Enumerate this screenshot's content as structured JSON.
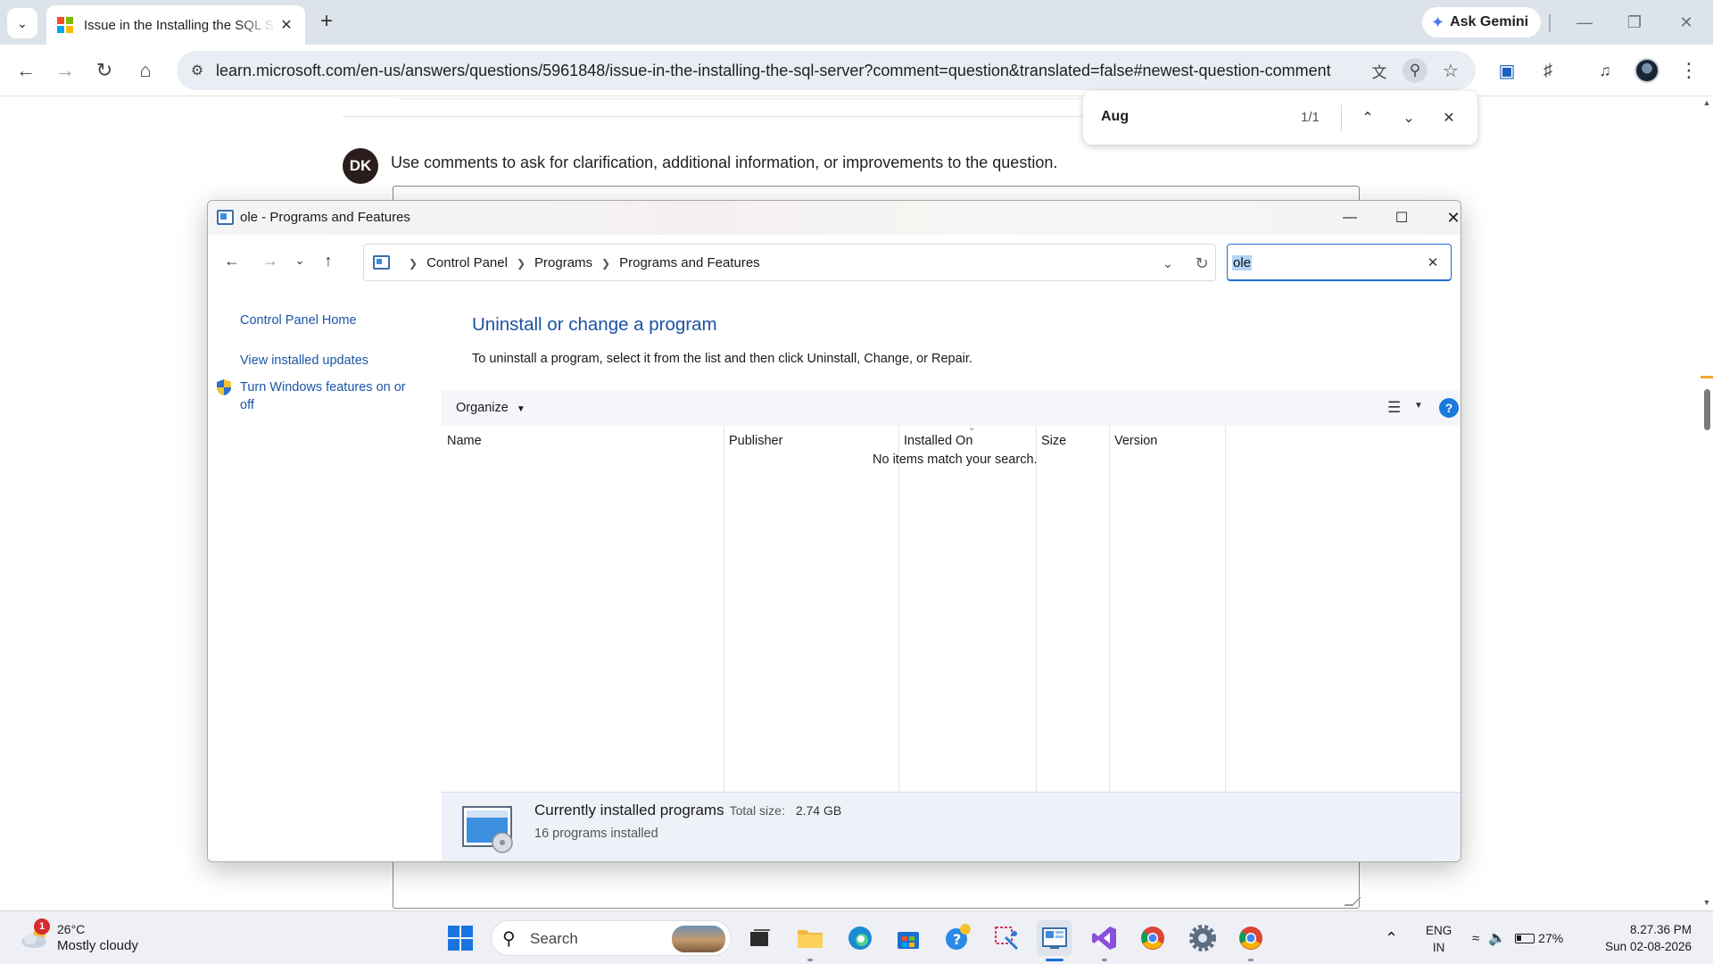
{
  "browser": {
    "tab": {
      "title": "Issue in the Installing the SQL S"
    },
    "ask_gemini": "Ask Gemini",
    "url": "learn.microsoft.com/en-us/answers/questions/5961848/issue-in-the-installing-the-sql-server?comment=question&translated=false#newest-question-comment"
  },
  "find_bar": {
    "query": "Aug",
    "count": "1/1"
  },
  "page": {
    "avatar_initials": "DK",
    "comment_hint": "Use comments to ask for clarification, additional information, or improvements to the question."
  },
  "window": {
    "title": "ole - Programs and Features",
    "breadcrumb": [
      "Control Panel",
      "Programs",
      "Programs and Features"
    ],
    "search_value": "ole",
    "left_links": {
      "home": "Control Panel Home",
      "updates": "View installed updates",
      "features_line1": "Turn Windows features on or",
      "features_line2": "off"
    },
    "heading": "Uninstall or change a program",
    "description": "To uninstall a program, select it from the list and then click Uninstall, Change, or Repair.",
    "organize": "Organize",
    "columns": [
      "Name",
      "Publisher",
      "Installed On",
      "Size",
      "Version"
    ],
    "empty_message": "No items match your search.",
    "details": {
      "title": "Currently installed programs",
      "size_label": "Total size:",
      "size_value": "2.74 GB",
      "count": "16 programs installed"
    }
  },
  "taskbar": {
    "weather": {
      "badge": "1",
      "temp": "26°C",
      "desc": "Mostly cloudy"
    },
    "search_text": "Search",
    "lang_line1": "ENG",
    "lang_line2": "IN",
    "battery": "27%",
    "time": "8.27.36 PM",
    "date": "Sun 02-08-2026"
  },
  "colors": {
    "link_blue": "#1b56a6",
    "heading_blue": "#1b52a3",
    "accent": "#1a6fd6",
    "ms_logo": [
      "#f25022",
      "#7fba00",
      "#00a4ef",
      "#ffb900"
    ]
  }
}
